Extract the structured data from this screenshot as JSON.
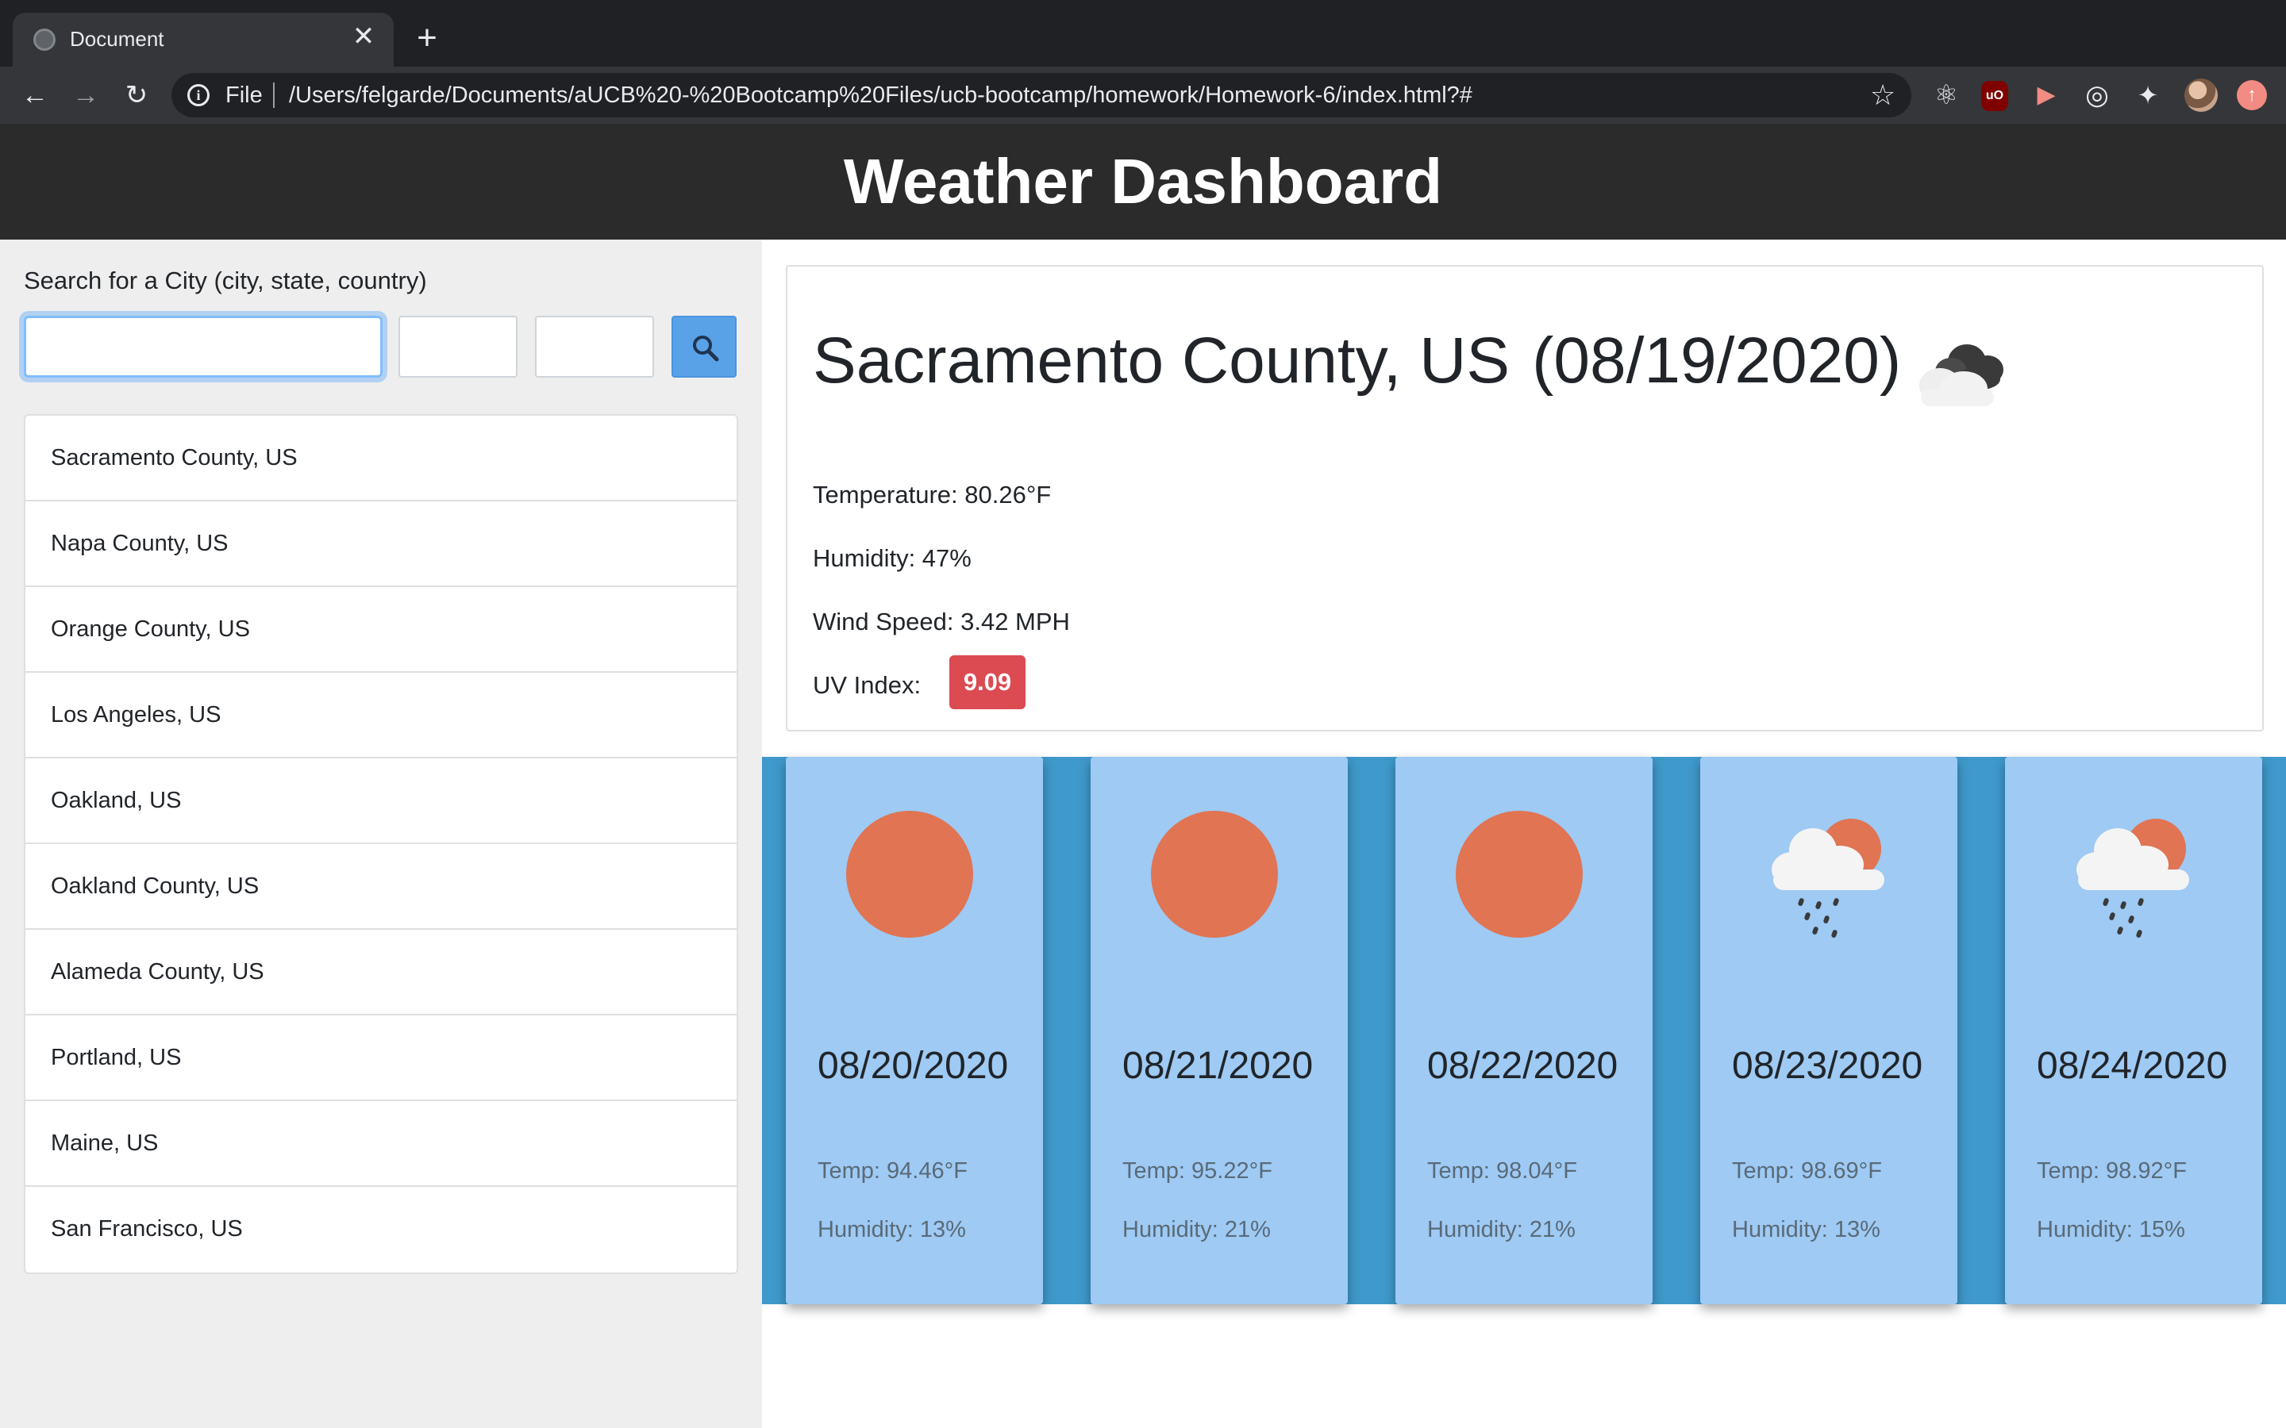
{
  "browser": {
    "tab_title": "Document",
    "tab_close": "✕",
    "new_tab": "+",
    "scheme": "File",
    "url": "/Users/felgarde/Documents/aUCB%20-%20Bootcamp%20Files/ucb-bootcamp/homework/Homework-6/index.html?#"
  },
  "header": {
    "title": "Weather Dashboard"
  },
  "search": {
    "label": "Search for a City (city, state, country)",
    "city_value": "",
    "state_value": "",
    "country_value": ""
  },
  "history": [
    "Sacramento County, US",
    "Napa County, US",
    "Orange County, US",
    "Los Angeles, US",
    "Oakland, US",
    "Oakland County, US",
    "Alameda County, US",
    "Portland, US",
    "Maine, US",
    "San Francisco, US"
  ],
  "current": {
    "city": "Sacramento County, US",
    "date": "(08/19/2020)",
    "icon": "cloud-icon",
    "temperature": "Temperature: 80.26°F",
    "humidity": "Humidity: 47%",
    "wind": "Wind Speed: 3.42 MPH",
    "uv_label": "UV Index:",
    "uv_value": "9.09",
    "uv_color": "#dc4a52"
  },
  "forecast": [
    {
      "date": "08/20/2020",
      "icon": "sun-icon",
      "temp": "Temp: 94.46°F",
      "humidity": "Humidity: 13%"
    },
    {
      "date": "08/21/2020",
      "icon": "sun-icon",
      "temp": "Temp: 95.22°F",
      "humidity": "Humidity: 21%"
    },
    {
      "date": "08/22/2020",
      "icon": "sun-icon",
      "temp": "Temp: 98.04°F",
      "humidity": "Humidity: 21%"
    },
    {
      "date": "08/23/2020",
      "icon": "rain-sun-icon",
      "temp": "Temp: 98.69°F",
      "humidity": "Humidity: 13%"
    },
    {
      "date": "08/24/2020",
      "icon": "rain-sun-icon",
      "temp": "Temp: 98.92°F",
      "humidity": "Humidity: 15%"
    }
  ],
  "colors": {
    "header_bg": "#2b2b2b",
    "sidebar_bg": "#eeeeee",
    "search_button": "#5aa2e8",
    "forecast_strip": "#3f99cb",
    "forecast_card": "#9ecaf4",
    "sun": "#e07453"
  }
}
